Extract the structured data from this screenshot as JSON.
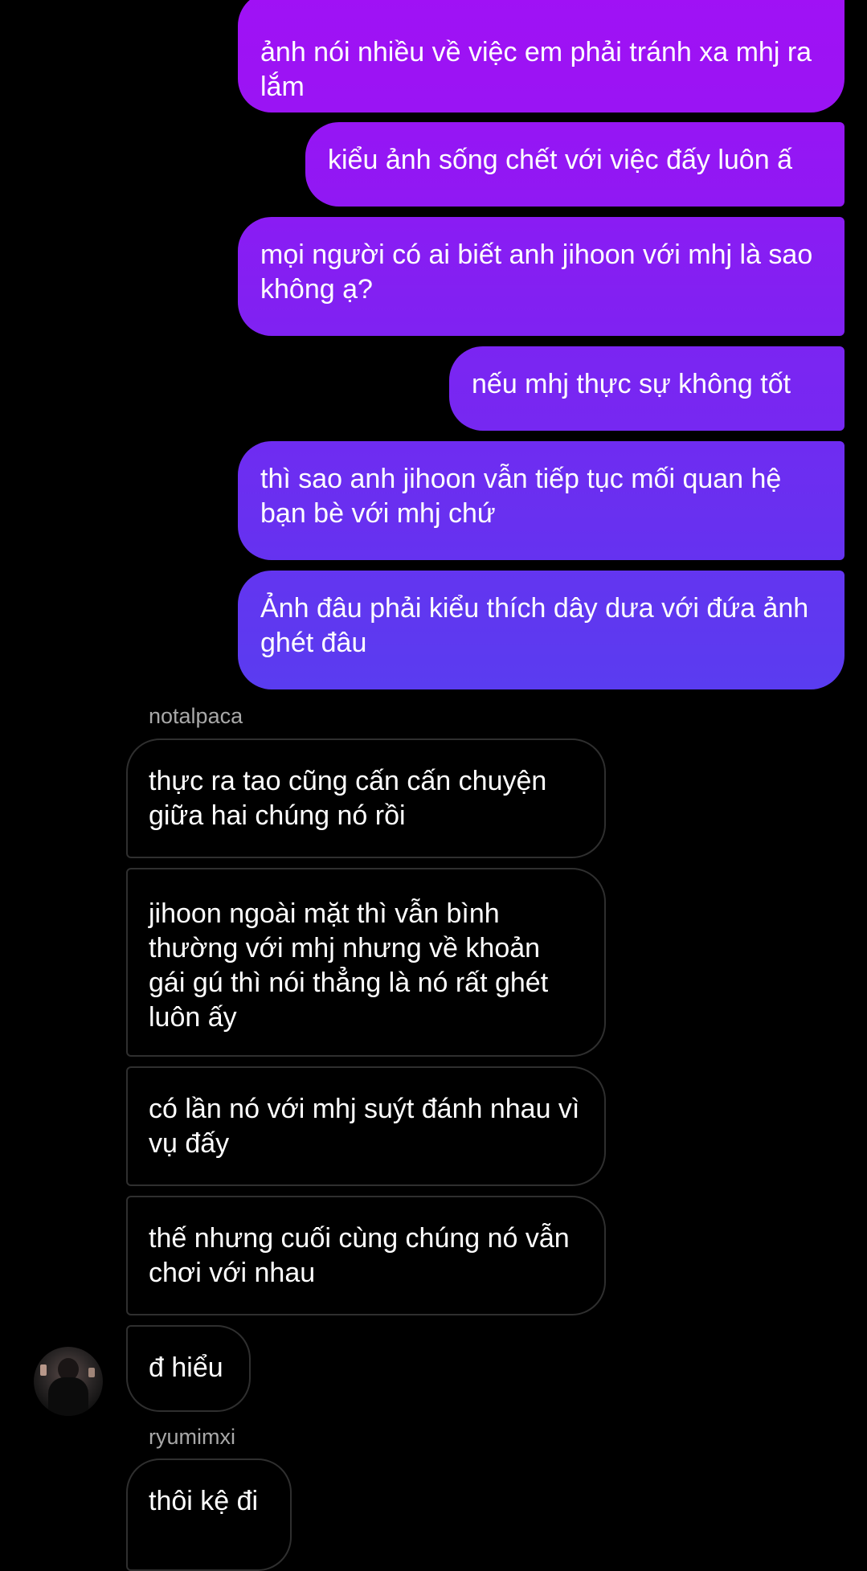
{
  "thread": {
    "outgoing": [
      {
        "text": "ảnh nói nhiều về việc em phải tránh xa mhj ra lắm"
      },
      {
        "text": "kiểu ảnh sống chết với việc đấy luôn ấ"
      },
      {
        "text": "mọi người có ai biết anh jihoon với mhj là sao không ạ?"
      },
      {
        "text": "nếu mhj thực sự không tốt"
      },
      {
        "text": "thì sao anh jihoon vẫn tiếp tục mối quan hệ bạn bè với mhj chứ"
      },
      {
        "text": "Ảnh đâu phải kiểu thích dây dưa với đứa ảnh ghét đâu"
      }
    ],
    "group1": {
      "sender": "notalpaca",
      "messages": [
        {
          "text": "thực ra tao cũng cấn cấn chuyện giữa hai chúng nó rồi"
        },
        {
          "text": "jihoon ngoài mặt thì vẫn bình thường với mhj nhưng về khoản gái gú thì nói thẳng là nó rất ghét luôn ấy"
        },
        {
          "text": "có lần nó với mhj suýt đánh nhau vì vụ đấy"
        },
        {
          "text": "thế nhưng cuối cùng chúng nó vẫn chơi với nhau"
        },
        {
          "text": "đ hiểu"
        }
      ]
    },
    "group2": {
      "sender": "ryumimxi",
      "messages": [
        {
          "text": "thôi kệ đi"
        }
      ]
    }
  },
  "colors": {
    "outgoing_gradient_top": "#a011f5",
    "outgoing_gradient_bottom": "#5a3cf0",
    "incoming_border": "#2f2f2f",
    "sender_text": "#a8a8a8",
    "background": "#000000"
  }
}
